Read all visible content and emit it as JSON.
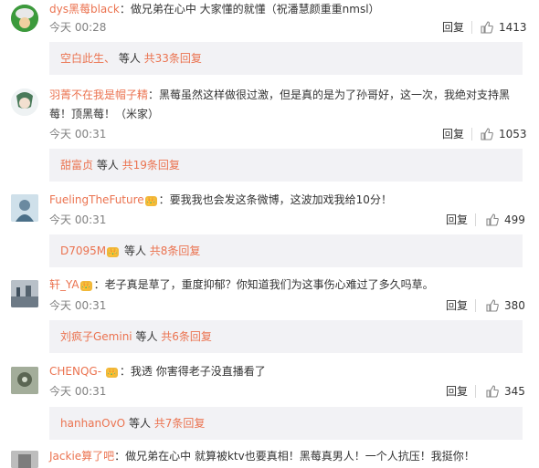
{
  "comments": [
    {
      "user": "dys黑莓black",
      "text": "：做兄弟在心中 大家懂的就懂（祝潘慧颜重重nmsl）",
      "time": "今天 00:28",
      "reply_label": "回复",
      "likes": "1413",
      "replies": {
        "prefix": "空白此生、",
        "mid": " 等人 ",
        "count": "共33条回复"
      }
    },
    {
      "user": "羽菁不在我是帽子精",
      "text_line1": "：黑莓虽然这样做很过激，但是真的是为了孙哥好，这一次，我绝对支持黑",
      "text_line2": "莓！顶黑莓！（米家）",
      "time": "今天 00:31",
      "reply_label": "回复",
      "likes": "1053",
      "replies": {
        "prefix": "甜富贞",
        "mid": " 等人 ",
        "count": "共19条回复"
      }
    },
    {
      "user": "FuelingTheFuture",
      "text": "：要我我也会发这条微博，这波加戏我给10分！",
      "time": "今天 00:31",
      "reply_label": "回复",
      "likes": "499",
      "replies": {
        "prefix": "D7095M",
        "mid": " 等人 ",
        "count": "共8条回复"
      }
    },
    {
      "user": "轩_YA",
      "text": "：老子真是草了，重度抑郁？你知道我们为这事伤心难过了多久吗草。",
      "time": "今天 00:31",
      "reply_label": "回复",
      "likes": "380",
      "replies": {
        "prefix": "刘疯子Gemini",
        "mid": " 等人 ",
        "count": "共6条回复"
      }
    },
    {
      "user": "CHENQG-",
      "text": "：我透 你害得老子没直播看了",
      "time": "今天 00:31",
      "reply_label": "回复",
      "likes": "345",
      "replies": {
        "prefix": "hanhanOvO",
        "mid": " 等人 ",
        "count": "共7条回复"
      }
    },
    {
      "user": "Jackie算了吧",
      "text": "：做兄弟在心中 就算被ktv也要真相！黑莓真男人！一个人抗压！我挺你！"
    }
  ],
  "badge_text": "👑",
  "colors": {
    "username": "#eb7350",
    "reply_bar_bg": "#f2f2f5",
    "time": "#808080"
  },
  "icons": {
    "like": "thumbs-up-icon",
    "badge": "member-crown-icon"
  }
}
